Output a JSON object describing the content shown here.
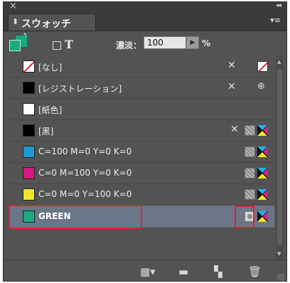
{
  "panel": {
    "close_glyph": "×",
    "collapse_glyph": "◂◂",
    "tab_updown_glyph": "⬍",
    "title": "スウォッチ",
    "menu_glyph": "▾≡"
  },
  "toolbar": {
    "fill_stroke_color": "#1ba97f",
    "swap_glyph": "↰",
    "format_text_label": "T",
    "tint_label": "濃淡：",
    "tint_value": "100",
    "tint_arrow": "▶",
    "tint_unit": "%"
  },
  "swatches": [
    {
      "name": "[なし]",
      "color": "none",
      "icons": [
        "pencil-x-icon",
        "none-swatch-icon"
      ]
    },
    {
      "name": "[レジストレーション]",
      "color": "#000000",
      "icons": [
        "pencil-x-icon",
        "registration-icon"
      ]
    },
    {
      "name": "[紙色]",
      "color": "#ffffff",
      "icons": []
    },
    {
      "name": "[黒]",
      "color": "#000000",
      "icons": [
        "pencil-x-icon",
        "spot-icon",
        "cmyk-icon"
      ]
    },
    {
      "name": "C=100 M=0 Y=0 K=0",
      "color": "#1b9ad6",
      "icons": [
        "spot-icon",
        "cmyk-icon"
      ]
    },
    {
      "name": "C=0 M=100 Y=0 K=0",
      "color": "#d6187f",
      "icons": [
        "spot-icon",
        "cmyk-icon"
      ]
    },
    {
      "name": "C=0 M=0 Y=100 K=0",
      "color": "#f2e629",
      "icons": [
        "spot-icon",
        "cmyk-icon"
      ]
    },
    {
      "name": "GREEN",
      "color": "#1ba97f",
      "icons": [
        "spot-boxed-icon",
        "cmyk-icon"
      ],
      "selected": true
    }
  ],
  "glyphs": {
    "pencil_x": "✕",
    "registration": "⊕",
    "scroll_up": "▲",
    "scroll_down": "▼",
    "show_kinds": "▦▾",
    "new_group": "▬",
    "new_swatch": "▚",
    "delete": "🗑"
  },
  "colors": {
    "highlight": "#e5202a",
    "panel_bg": "#535353",
    "selected_row": "#6a7688"
  }
}
